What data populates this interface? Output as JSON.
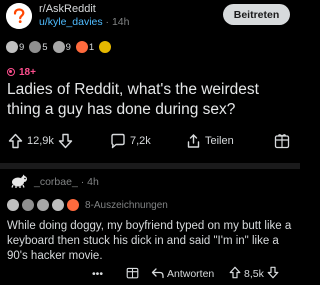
{
  "post": {
    "subreddit": "r/AskReddit",
    "author": "u/kyle_davies",
    "separator": " · ",
    "age": "14h",
    "join_label": "Beitreten",
    "awards": [
      {
        "icon": "silver-award-icon",
        "color": "#c0c0c0",
        "count": "9"
      },
      {
        "icon": "wholesome-award-icon",
        "color": "#8f8f8f",
        "count": "5"
      },
      {
        "icon": "helpful-award-icon",
        "color": "#a7a7a7",
        "count": "9"
      },
      {
        "icon": "rocket-award-icon",
        "color": "#ff6a3d",
        "count": "1"
      },
      {
        "icon": "gold-award-icon",
        "color": "#e6b800",
        "count": ""
      }
    ],
    "nsfw_label": "18+",
    "title": "Ladies of Reddit, what's the weirdest thing a guy has done during sex?",
    "upvotes": "12,9k",
    "comments": "7,2k",
    "share_label": "Teilen"
  },
  "comment": {
    "author": "_corbae_",
    "separator": " · ",
    "age": "4h",
    "awards_label": "8-Auszeichnungen",
    "body": "While doing doggy, my boyfriend typed on my butt like a keyboard then stuck his dick in and said \"I'm in\" like a 90's hacker movie.",
    "more_label": "•••",
    "reply_label": "Antworten",
    "votes": "8,5k"
  },
  "colors": {
    "background": "#000000",
    "username_blue": "#4fbcff",
    "nsfw_pink": "#ff4f8f",
    "muted": "#818384"
  }
}
